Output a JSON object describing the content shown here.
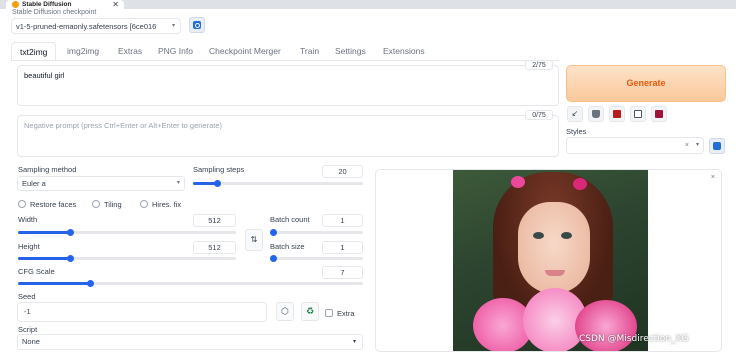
{
  "browser": {
    "tab_title": "Stable Diffusion",
    "close_glyph": "✕"
  },
  "checkpoint": {
    "label": "Stable Diffusion checkpoint",
    "value": "v1-5-pruned-emaonly.safetensors [6ce016"
  },
  "tabs": [
    "txt2img",
    "img2img",
    "Extras",
    "PNG Info",
    "Checkpoint Merger",
    "Train",
    "Settings",
    "Extensions"
  ],
  "prompt": {
    "value": "beautiful girl",
    "counter": "2/75"
  },
  "negative_prompt": {
    "placeholder": "Negative prompt (press Ctrl+Enter or Alt+Enter to generate)",
    "counter": "0/75"
  },
  "generate_label": "Generate",
  "tools": [
    {
      "icon": "arrow-diagonal-icon",
      "glyph": "↙",
      "color": "#374151"
    },
    {
      "icon": "trash-icon",
      "glyph": "",
      "color": "#6b7280"
    },
    {
      "icon": "red-card-icon",
      "glyph": "",
      "color": "#b91c1c"
    },
    {
      "icon": "clipboard-icon",
      "glyph": "",
      "color": "#4b5563"
    },
    {
      "icon": "save-style-icon",
      "glyph": "",
      "color": "#9f1239"
    }
  ],
  "styles": {
    "label": "Styles",
    "clear": "×",
    "chevron": "▾"
  },
  "sampling": {
    "method_label": "Sampling method",
    "method_value": "Euler a",
    "steps_label": "Sampling steps",
    "steps_value": "20",
    "steps_fraction": 0.14
  },
  "options": {
    "restore_faces": "Restore faces",
    "tiling": "Tiling",
    "hires_fix": "Hires. fix"
  },
  "width": {
    "label": "Width",
    "value": "512",
    "fraction": 0.24
  },
  "height": {
    "label": "Height",
    "value": "512",
    "fraction": 0.24
  },
  "batch_count": {
    "label": "Batch count",
    "value": "1",
    "fraction": 0.0
  },
  "batch_size": {
    "label": "Batch size",
    "value": "1",
    "fraction": 0.0
  },
  "swap_glyph": "⇅",
  "cfg": {
    "label": "CFG Scale",
    "value": "7",
    "fraction": 0.21
  },
  "seed": {
    "label": "Seed",
    "value": "-1",
    "extra_label": "Extra",
    "dice_glyph": "⬡",
    "recycle_glyph": "♻"
  },
  "script": {
    "label": "Script",
    "value": "None"
  },
  "gallery": {
    "close_glyph": "×"
  },
  "watermark": "CSDN @Misdirection_XG",
  "colors": {
    "accent": "#2563eb",
    "generate_text": "#e8590c"
  }
}
